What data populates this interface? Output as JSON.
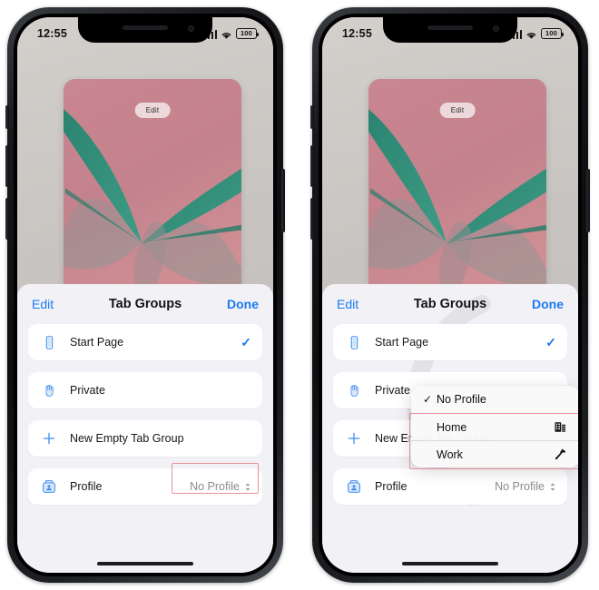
{
  "status_bar": {
    "time": "12:55",
    "cellular_icon": "signal-bars-icon",
    "wifi_icon": "wifi-icon",
    "battery_label": "100"
  },
  "tab_card": {
    "edit_label": "Edit"
  },
  "sheet": {
    "edit_label": "Edit",
    "title": "Tab Groups",
    "done_label": "Done",
    "rows": [
      {
        "icon": "iphone-icon",
        "label": "Start Page",
        "trailing": "check",
        "check": "✓"
      },
      {
        "icon": "hand-raised-icon",
        "label": "Private",
        "trailing": "none"
      },
      {
        "icon": "plus-icon",
        "label": "New Empty Tab Group",
        "trailing": "none"
      },
      {
        "icon": "person-card-icon",
        "label": "Profile",
        "trailing": "value",
        "value": "No Profile"
      }
    ]
  },
  "dropdown": {
    "items": [
      {
        "label": "No Profile",
        "checked": true,
        "check": "✓",
        "icon": "none"
      },
      {
        "label": "Home",
        "checked": false,
        "check": "",
        "icon": "building-icon"
      },
      {
        "label": "Work",
        "checked": false,
        "check": "",
        "icon": "hammer-icon"
      }
    ]
  },
  "annotations": {
    "highlight_color": "#e8909a",
    "left_target": "No Profile",
    "right_target": "Home / Work"
  },
  "colors": {
    "accent_blue": "#1a7bf2",
    "sheet_background": "#f2f1f6",
    "row_background": "#ffffff",
    "card_pink": "#c8868f",
    "card_teal": "#2f8c78",
    "wallpaper_gray": "#c8c4c1"
  }
}
